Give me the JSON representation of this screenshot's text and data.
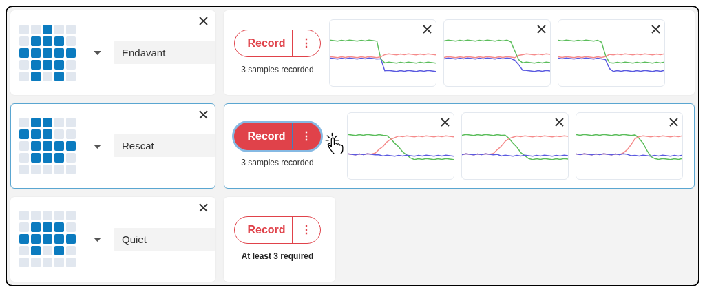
{
  "gestures": [
    {
      "name": "Endavant",
      "selected": false,
      "led_rows": [
        [
          false,
          false,
          true,
          false,
          false
        ],
        [
          false,
          true,
          true,
          true,
          false
        ],
        [
          true,
          true,
          true,
          true,
          true
        ],
        [
          false,
          true,
          true,
          true,
          false
        ],
        [
          false,
          true,
          false,
          true,
          false
        ]
      ],
      "record": {
        "label": "Record",
        "menu": "⋮",
        "recording": false
      },
      "caption": {
        "kind": "count",
        "text": "3 samples recorded"
      },
      "samples": [
        {
          "kind": "trace"
        },
        {
          "kind": "trace"
        },
        {
          "kind": "trace"
        }
      ]
    },
    {
      "name": "Rescat",
      "selected": true,
      "led_rows": [
        [
          false,
          true,
          true,
          false,
          false
        ],
        [
          true,
          true,
          true,
          false,
          false
        ],
        [
          false,
          true,
          true,
          true,
          true
        ],
        [
          false,
          true,
          true,
          true,
          false
        ],
        [
          false,
          false,
          false,
          false,
          false
        ]
      ],
      "record": {
        "label": "Record",
        "menu": "⋮",
        "recording": true
      },
      "caption": {
        "kind": "count",
        "text": "3 samples recorded"
      },
      "samples": [
        {
          "kind": "trace"
        },
        {
          "kind": "trace"
        },
        {
          "kind": "trace"
        }
      ]
    },
    {
      "name": "Quiet",
      "selected": false,
      "led_rows": [
        [
          false,
          false,
          false,
          false,
          false
        ],
        [
          false,
          true,
          true,
          true,
          false
        ],
        [
          true,
          true,
          true,
          true,
          true
        ],
        [
          false,
          true,
          false,
          true,
          false
        ],
        [
          false,
          false,
          false,
          false,
          false
        ]
      ],
      "record": {
        "label": "Record",
        "menu": "⋮",
        "recording": false
      },
      "caption": {
        "kind": "warning",
        "text": "At least 3 required"
      }
    }
  ],
  "cursor": {
    "kind": "pointer"
  }
}
